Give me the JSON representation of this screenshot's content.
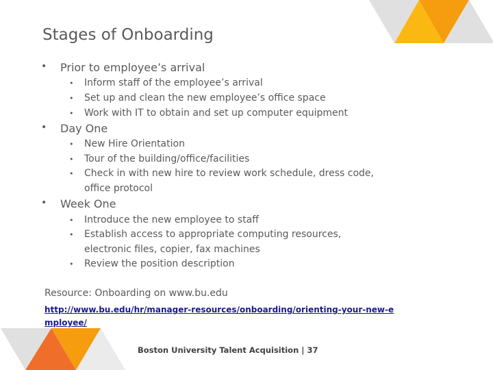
{
  "slide": {
    "title": "Stages of Onboarding",
    "sections": [
      {
        "heading": "Prior to employee’s arrival",
        "items": [
          "Inform staff of the employee’s arrival",
          "Set up and clean the new employee’s office space",
          "Work with IT to obtain and set up computer equipment"
        ]
      },
      {
        "heading": "Day One",
        "items": [
          "New Hire Orientation",
          "Tour of the building/office/facilities",
          "Check in with new hire to review work schedule, dress code, office protocol"
        ]
      },
      {
        "heading": "Week One",
        "items": [
          "Introduce the new employee to staff",
          "Establish access to appropriate computing resources, electronic files, copier, fax machines",
          "Review the position description"
        ]
      }
    ],
    "bullet": "•",
    "resource_label": "Resource: Onboarding on www.bu.edu",
    "resource_link": "http://www.bu.edu/hr/manager-resources/onboarding/orienting-your-new-employee/",
    "footer": "Boston University Talent Acquisition | 37"
  },
  "colors": {
    "gray": "#e0e0e0",
    "light_gray": "#ebebeb",
    "yellow": "#fbb812",
    "orange": "#f59c0f",
    "orange_red": "#ef6f2a",
    "link": "#1a1a8c",
    "text": "#595959"
  }
}
